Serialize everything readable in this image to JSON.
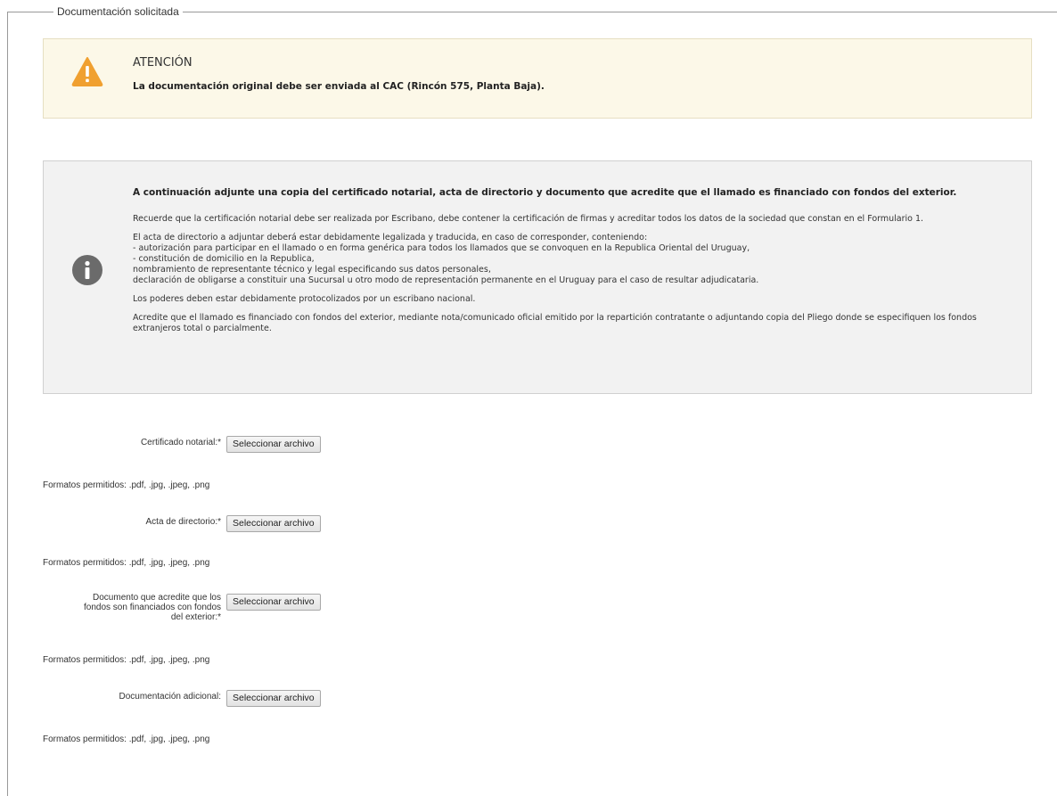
{
  "fieldset": {
    "legend": "Documentación solicitada"
  },
  "warning": {
    "icon": "warning-triangle-icon",
    "color": "#f0a030",
    "title": "ATENCIÓN",
    "text": "La documentación original debe ser enviada al CAC (Rincón 575, Planta Baja)."
  },
  "info": {
    "icon": "info-circle-icon",
    "lead": "A continuación adjunte una copia del certificado notarial, acta de directorio y documento que acredite que el llamado es financiado con fondos del exterior.",
    "p1": "Recuerde que la certificación notarial debe ser realizada por Escribano, debe contener la certificación de firmas y acreditar todos los datos de la sociedad que constan en el Formulario 1.",
    "p2_lines": [
      "El acta de directorio a adjuntar deberá estar debidamente legalizada y traducida, en caso de corresponder, conteniendo:",
      "- autorización para participar en el llamado o en forma genérica para todos los llamados que se convoquen en la Republica Oriental del Uruguay,",
      "- constitución de domicilio en la Republica,",
      "nombramiento de representante técnico y legal especificando sus datos personales,",
      "declaración de obligarse a constituir una Sucursal u otro modo de representación permanente en el Uruguay para el caso de resultar adjudicataria."
    ],
    "p3": "Los poderes deben estar debidamente protocolizados por un escribano nacional.",
    "p4": "Acredite que el llamado es financiado con fondos del exterior, mediante nota/comunicado oficial emitido por la repartición contratante o adjuntando copia del Pliego donde se especifiquen los fondos extranjeros total o parcialmente."
  },
  "uploads": [
    {
      "label": "Certificado notarial:*",
      "button": "Seleccionar archivo",
      "formats": "Formatos permitidos: .pdf, .jpg, .jpeg, .png"
    },
    {
      "label": "Acta de directorio:*",
      "button": "Seleccionar archivo",
      "formats": "Formatos permitidos: .pdf, .jpg, .jpeg, .png"
    },
    {
      "label_lines": [
        "Documento que acredite que los",
        "fondos son financiados con fondos",
        "del exterior:*"
      ],
      "button": "Seleccionar archivo",
      "formats": "Formatos permitidos: .pdf, .jpg, .jpeg, .png"
    },
    {
      "label": "Documentación adicional:",
      "button": "Seleccionar archivo",
      "formats": "Formatos permitidos: .pdf, .jpg, .jpeg, .png"
    }
  ]
}
